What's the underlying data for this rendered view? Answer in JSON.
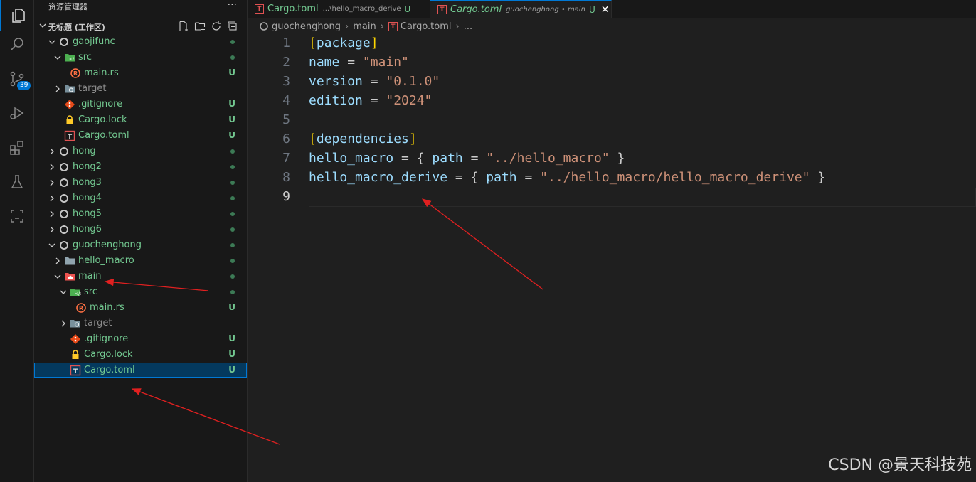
{
  "activity_bar": {
    "items": [
      {
        "icon": "files-icon"
      },
      {
        "icon": "search-icon"
      },
      {
        "icon": "source-control-icon",
        "badge": "39"
      },
      {
        "icon": "run-debug-icon"
      },
      {
        "icon": "extensions-icon"
      },
      {
        "icon": "testing-icon"
      },
      {
        "icon": "remote-explorer-icon"
      }
    ]
  },
  "sidebar": {
    "title": "资源管理器",
    "more": "···",
    "workspace_title": "无标题 (工作区)",
    "tree": [
      {
        "label": "gaojifunc",
        "type": "root",
        "status": "dot"
      },
      {
        "label": "src",
        "type": "folder-src",
        "status": "dot"
      },
      {
        "label": "main.rs",
        "type": "rust",
        "status": "U"
      },
      {
        "label": "target",
        "type": "folder-target",
        "status": ""
      },
      {
        "label": ".gitignore",
        "type": "git",
        "status": "U"
      },
      {
        "label": "Cargo.lock",
        "type": "lock",
        "status": "U"
      },
      {
        "label": "Cargo.toml",
        "type": "toml",
        "status": "U"
      },
      {
        "label": "hong",
        "type": "root",
        "status": "dot"
      },
      {
        "label": "hong2",
        "type": "root",
        "status": "dot"
      },
      {
        "label": "hong3",
        "type": "root",
        "status": "dot"
      },
      {
        "label": "hong4",
        "type": "root",
        "status": "dot"
      },
      {
        "label": "hong5",
        "type": "root",
        "status": "dot"
      },
      {
        "label": "hong6",
        "type": "root",
        "status": "dot"
      },
      {
        "label": "guochenghong",
        "type": "root",
        "status": "dot"
      },
      {
        "label": "hello_macro",
        "type": "folder",
        "status": "dot"
      },
      {
        "label": "main",
        "type": "folder-main",
        "status": "dot"
      },
      {
        "label": "src",
        "type": "folder-src",
        "status": "dot"
      },
      {
        "label": "main.rs",
        "type": "rust",
        "status": "U"
      },
      {
        "label": "target",
        "type": "folder-target",
        "status": ""
      },
      {
        "label": ".gitignore",
        "type": "git",
        "status": "U"
      },
      {
        "label": "Cargo.lock",
        "type": "lock",
        "status": "U"
      },
      {
        "label": "Cargo.toml",
        "type": "toml",
        "status": "U"
      }
    ]
  },
  "tabs": [
    {
      "name": "Cargo.toml",
      "desc": "...\\hello_macro_derive",
      "status": "U"
    },
    {
      "name": "Cargo.toml",
      "desc": "guochenghong • main",
      "status": "U",
      "close": "✕"
    }
  ],
  "breadcrumb": [
    "guochenghong",
    "main",
    "Cargo.toml",
    "..."
  ],
  "editor": {
    "line_numbers": [
      "1",
      "2",
      "3",
      "4",
      "5",
      "6",
      "7",
      "8",
      "9"
    ],
    "lines": {
      "l1": {
        "b1": "[",
        "k": "package",
        "b2": "]"
      },
      "l2": {
        "k": "name",
        "eq": " = ",
        "s": "\"main\""
      },
      "l3": {
        "k": "version",
        "eq": " = ",
        "s": "\"0.1.0\""
      },
      "l4": {
        "k": "edition",
        "eq": " = ",
        "s": "\"2024\""
      },
      "l6": {
        "b1": "[",
        "k": "dependencies",
        "b2": "]"
      },
      "l7": {
        "k": "hello_macro",
        "eq": " = ",
        "ob": "{ ",
        "k2": "path",
        "eq2": " = ",
        "s": "\"../hello_macro\"",
        "cb": " }"
      },
      "l8": {
        "k": "hello_macro_derive",
        "eq": " = ",
        "ob": "{ ",
        "k2": "path",
        "eq2": " = ",
        "s": "\"../hello_macro/hello_macro_derive\"",
        "cb": " }"
      }
    }
  },
  "watermark": "CSDN @景天科技苑",
  "colors": {
    "accent": "#0078d4",
    "untracked": "#73c991",
    "arrow": "#e02020"
  }
}
